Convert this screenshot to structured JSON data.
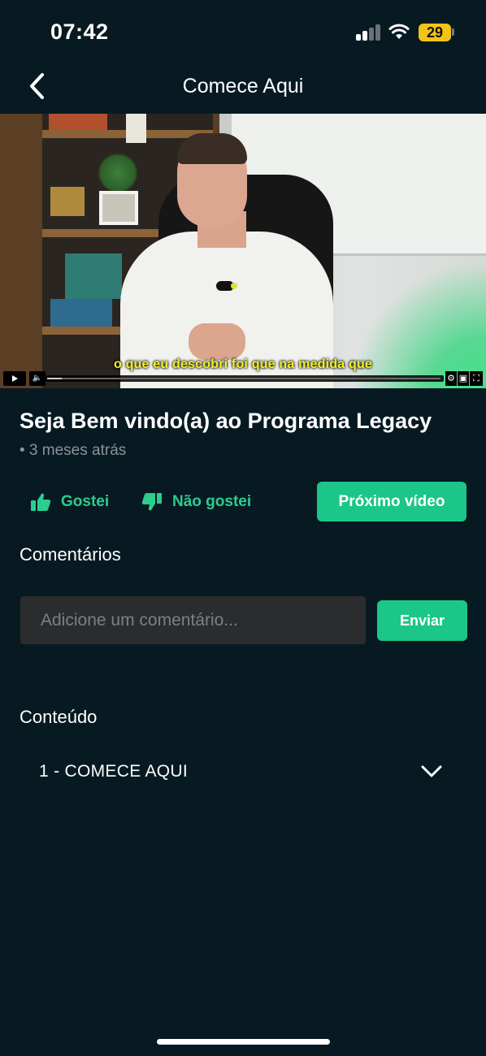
{
  "status_bar": {
    "time": "07:42",
    "battery_level": "29",
    "icons": [
      "signal-icon",
      "wifi-icon",
      "battery-icon"
    ]
  },
  "header": {
    "title": "Comece Aqui",
    "back_icon": "chevron-left-icon"
  },
  "video": {
    "subtitle": "o que eu descobri foi que na medida que",
    "controls": [
      "play-icon",
      "volume-icon",
      "settings-icon",
      "pip-icon",
      "fullscreen-icon"
    ],
    "progress": 0.04
  },
  "details": {
    "title": "Seja Bem vindo(a) ao Programa Legacy",
    "meta": "• 3 meses atrás"
  },
  "actions": {
    "like_label": "Gostei",
    "dislike_label": "Não gostei",
    "next_label": "Próximo vídeo"
  },
  "comments": {
    "heading": "Comentários",
    "placeholder": "Adicione um comentário...",
    "send_label": "Enviar"
  },
  "content": {
    "heading": "Conteúdo",
    "modules": [
      {
        "label": "1 - COMECE AQUI",
        "icon": "chevron-down-icon"
      }
    ]
  },
  "colors": {
    "background": "#071a22",
    "accent": "#1bc688",
    "accent_text": "#2dcc8f",
    "input_bg": "#2b2c2e",
    "battery": "#f2c418"
  }
}
